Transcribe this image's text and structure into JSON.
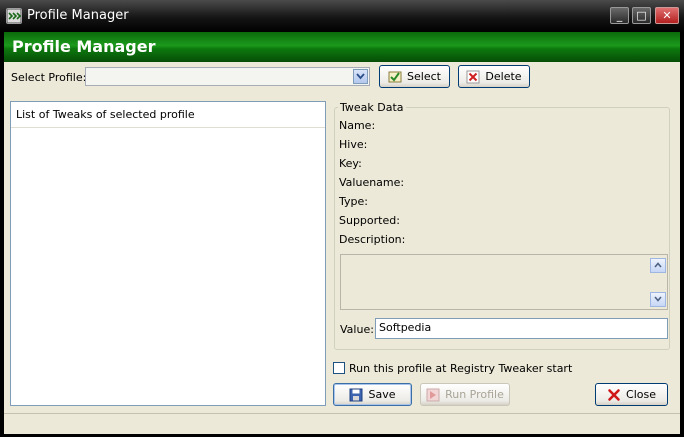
{
  "window": {
    "title": "Profile Manager",
    "minimize": "_",
    "maximize": "□",
    "close": "✕"
  },
  "header": {
    "title": "Profile Manager"
  },
  "select_profile": {
    "label": "Select Profile:",
    "value": "",
    "select_button": "Select",
    "delete_button": "Delete"
  },
  "tweak_list": {
    "header": "List of Tweaks of selected profile",
    "items": []
  },
  "tweak_data": {
    "legend": "Tweak Data",
    "name_label": "Name:",
    "hive_label": "Hive:",
    "key_label": "Key:",
    "valuename_label": "Valuename:",
    "type_label": "Type:",
    "supported_label": "Supported:",
    "description_label": "Description:",
    "description_value": "",
    "value_label": "Value:",
    "value": "Softpedia"
  },
  "startup_checkbox": {
    "label": "Run this profile at Registry Tweaker start",
    "checked": false
  },
  "actions": {
    "save": "Save",
    "run_profile": "Run Profile",
    "close": "Close"
  },
  "colors": {
    "header_green": "#0e7a0e",
    "window_bg": "#ece9d8",
    "input_border": "#7f9db9"
  }
}
